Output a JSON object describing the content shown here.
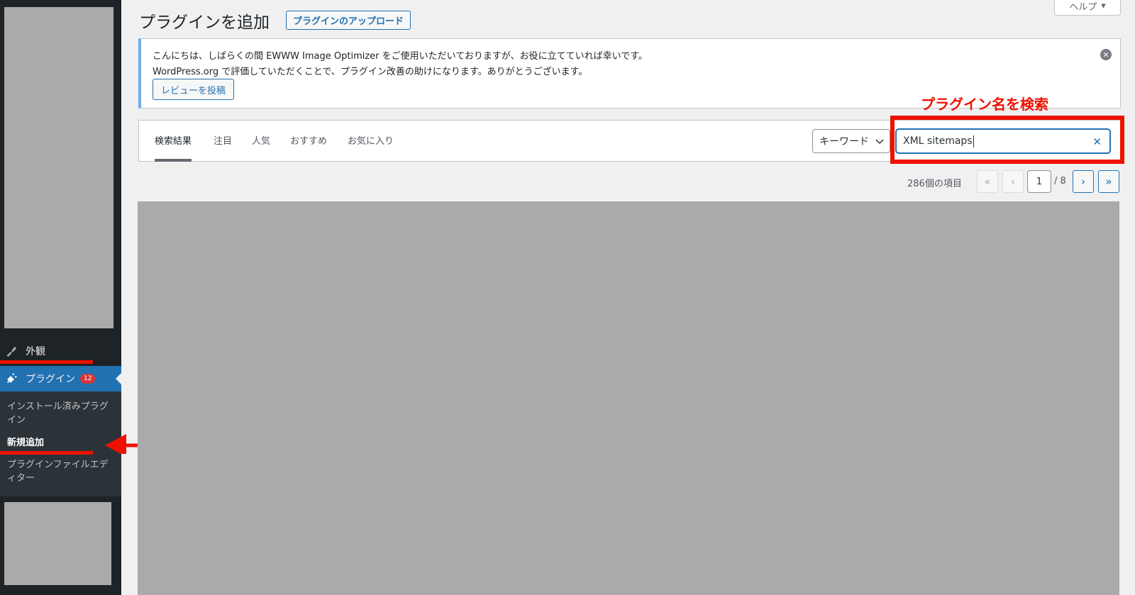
{
  "sidebar": {
    "appearance_label": "外観",
    "plugins_label": "プラグイン",
    "plugins_badge": "12",
    "submenu": {
      "installed": "インストール済みプラグイン",
      "add_new": "新規追加",
      "editor": "プラグインファイルエディター"
    }
  },
  "header": {
    "title": "プラグインを追加",
    "upload_label": "プラグインのアップロード",
    "help_label": "ヘルプ"
  },
  "notice": {
    "line1": "こんにちは、しばらくの間 EWWW Image Optimizer をご使用いただいておりますが、お役に立てていれば幸いです。",
    "line2": "WordPress.org で評価していただくことで、プラグイン改善の助けになります。ありがとうございます。",
    "review_button": "レビューを投稿"
  },
  "tabs": [
    {
      "label": "検索結果",
      "current": true
    },
    {
      "label": "注目",
      "current": false
    },
    {
      "label": "人気",
      "current": false
    },
    {
      "label": "おすすめ",
      "current": false
    },
    {
      "label": "お気に入り",
      "current": false
    }
  ],
  "search": {
    "type_label": "キーワード",
    "value": "XML sitemaps"
  },
  "annotation": {
    "text": "プラグイン名を検索",
    "color": "#ee1100"
  },
  "pagination": {
    "item_count": "286個の項目",
    "current_page": "1",
    "total_pages": "/ 8",
    "first": "«",
    "prev": "‹",
    "next": "›",
    "last": "»"
  },
  "colors": {
    "sidebar_bg": "#1d2327",
    "accent": "#2271b1",
    "badge": "#d63638"
  }
}
